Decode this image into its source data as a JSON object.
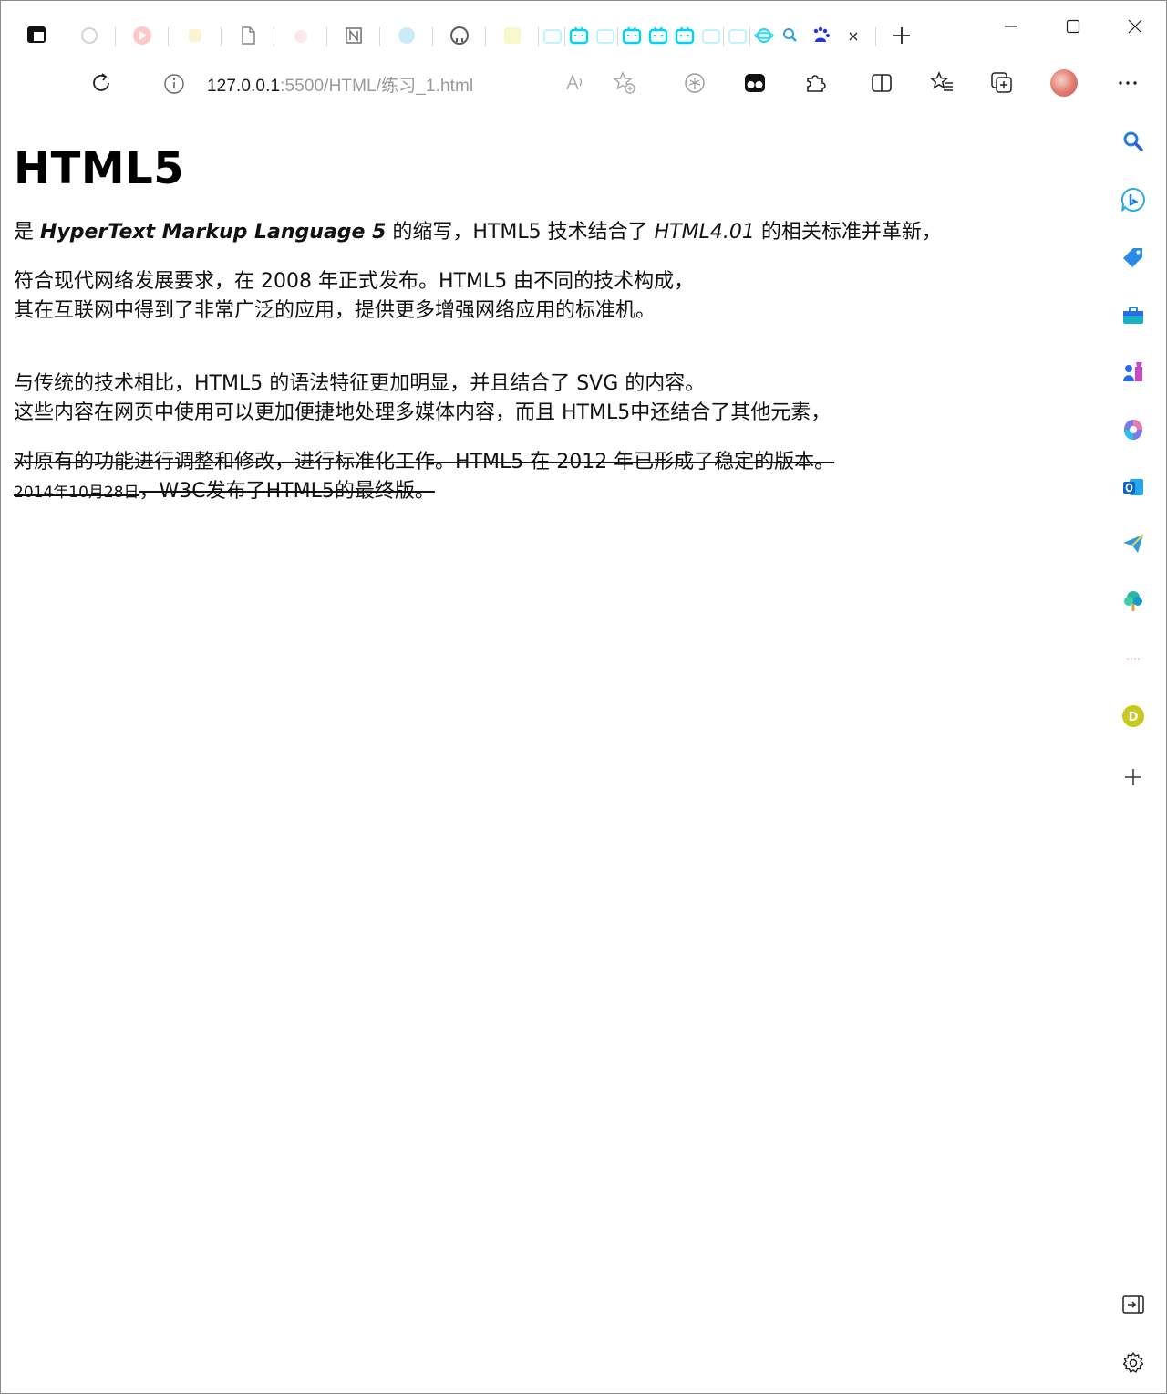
{
  "browser": {
    "tabs": [
      {
        "name": "tab-1",
        "icon": "refresh-icon"
      },
      {
        "name": "tab-2",
        "icon": "youtube-icon"
      },
      {
        "name": "tab-3",
        "icon": "doc-yellow-icon"
      },
      {
        "name": "tab-4",
        "icon": "document-icon"
      },
      {
        "name": "tab-5",
        "icon": "cat-icon"
      },
      {
        "name": "tab-6",
        "icon": "notion-icon"
      },
      {
        "name": "tab-7",
        "icon": "globe-icon"
      },
      {
        "name": "tab-8",
        "icon": "github-icon"
      },
      {
        "name": "tab-9",
        "icon": "m-icon"
      },
      {
        "name": "tab-10",
        "icon": "bilibili-icon"
      },
      {
        "name": "tab-11",
        "icon": "bilibili-icon"
      },
      {
        "name": "tab-12",
        "icon": "bilibili-icon"
      },
      {
        "name": "tab-13",
        "icon": "bilibili-icon"
      },
      {
        "name": "tab-14",
        "icon": "bilibili-icon"
      },
      {
        "name": "tab-15",
        "icon": "bilibili-icon"
      },
      {
        "name": "tab-16",
        "icon": "bilibili-icon"
      },
      {
        "name": "tab-17",
        "icon": "bilibili-icon"
      },
      {
        "name": "tab-18",
        "icon": "planet-icon"
      },
      {
        "name": "tab-19",
        "icon": "search-icon"
      }
    ],
    "active_tab": {
      "icon": "baidu-icon",
      "close": "×"
    },
    "new_tab": "+",
    "address": {
      "host": "127.0.0.1",
      "path": ":5500/HTML/练习_1.html"
    }
  },
  "page": {
    "title": "HTML5",
    "p1": {
      "a": "是 ",
      "b": "HyperText Markup Language 5",
      "c": " 的缩写，HTML5 技术结合了 ",
      "d": "HTML4.01",
      "e": " 的相关标准并革新，"
    },
    "p2": {
      "line1": "符合现代网络发展要求，在 2008 年正式发布。HTML5 由不同的技术构成，",
      "line2": "其在互联网中得到了非常广泛的应用，提供更多增强网络应用的标准机。"
    },
    "p3": {
      "line1": "与传统的技术相比，HTML5 的语法特征更加明显，并且结合了 SVG 的内容。",
      "line2": "这些内容在网页中使用可以更加便捷地处理多媒体内容，而且 HTML5中还结合了其他元素，"
    },
    "p4": {
      "line1": "对原有的功能进行调整和修改，进行标准化工作。HTML5 在 2012 年已形成了稳定的版本。",
      "small": "2014年10月28日",
      "rest": "，W3C发布了HTML5的最终版。"
    }
  },
  "sidebar": {
    "items": [
      "search-icon",
      "bing-chat-icon",
      "shopping-tag-icon",
      "tools-icon",
      "games-icon",
      "copilot-icon",
      "outlook-icon",
      "send-icon",
      "tree-icon",
      "daily-icon",
      "d-icon",
      "add-icon"
    ],
    "bottom": [
      "sidebar-collapse-icon",
      "settings-icon"
    ]
  },
  "colors": {
    "accent_cyan": "#2fd2e8",
    "bilibili": "#00d4f0",
    "baidu_blue": "#2932e1",
    "text": "#111111",
    "address_path": "#9a9a9a"
  }
}
